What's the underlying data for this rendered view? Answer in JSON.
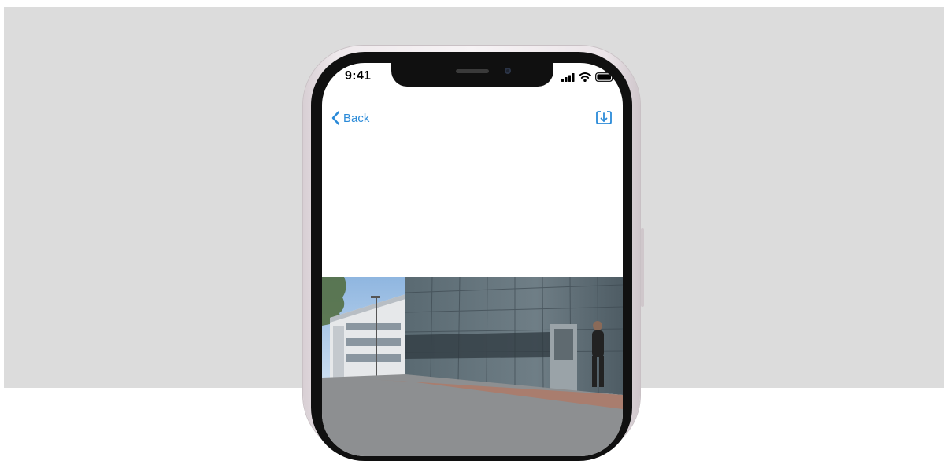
{
  "status_bar": {
    "time": "9:41",
    "icons": [
      "signal-icon",
      "wifi-icon",
      "battery-icon"
    ]
  },
  "nav_bar": {
    "back_label": "Back",
    "back_icon": "chevron-left-icon",
    "action_icon": "download-icon"
  },
  "colors": {
    "accent": "#2a8ad8",
    "background": "#dcdcdc"
  }
}
